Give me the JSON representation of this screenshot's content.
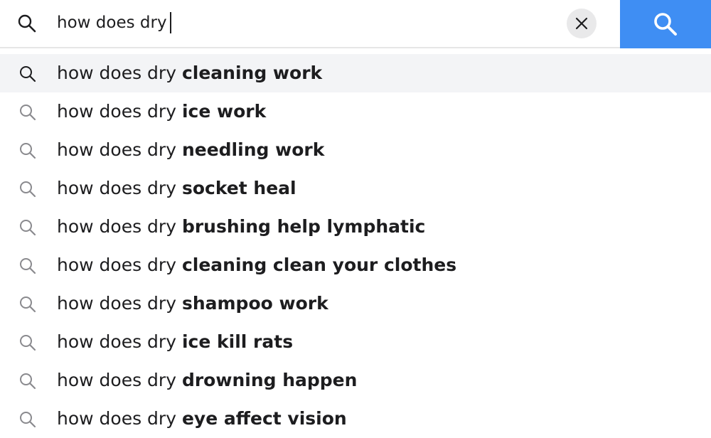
{
  "search": {
    "query": "how does dry",
    "clear_label": "×",
    "submit_icon": "search-icon"
  },
  "colors": {
    "submit_bg": "#3f8ef3",
    "highlight_bg": "#f3f4f6",
    "clear_bg": "#e9e9ea"
  },
  "suggestions": [
    {
      "prefix": "how does dry ",
      "completion": "cleaning work",
      "highlighted": true
    },
    {
      "prefix": "how does dry ",
      "completion": "ice work"
    },
    {
      "prefix": "how does dry ",
      "completion": "needling work"
    },
    {
      "prefix": "how does dry ",
      "completion": "socket heal"
    },
    {
      "prefix": "how does dry ",
      "completion": "brushing help lymphatic"
    },
    {
      "prefix": "how does dry ",
      "completion": "cleaning clean your clothes"
    },
    {
      "prefix": "how does dry ",
      "completion": "shampoo work"
    },
    {
      "prefix": "how does dry ",
      "completion": "ice kill rats"
    },
    {
      "prefix": "how does dry ",
      "completion": "drowning happen"
    },
    {
      "prefix": "how does dry ",
      "completion": "eye affect vision"
    }
  ]
}
